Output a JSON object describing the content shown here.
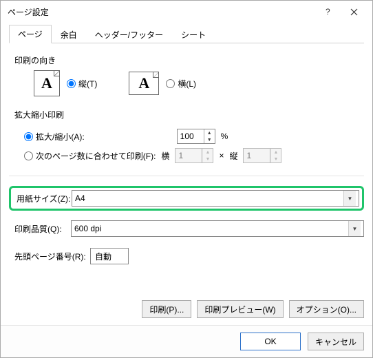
{
  "titlebar": {
    "title": "ページ設定"
  },
  "tabs": [
    "ページ",
    "余白",
    "ヘッダー/フッター",
    "シート"
  ],
  "orientation": {
    "section": "印刷の向き",
    "portrait": "縦(T)",
    "landscape": "横(L)"
  },
  "scaling": {
    "section": "拡大縮小印刷",
    "adjust": "拡大/縮小(A):",
    "adjust_value": "100",
    "percent": "%",
    "fit": "次のページ数に合わせて印刷(F):",
    "wide_label": "横",
    "wide_value": "1",
    "times": "×",
    "tall_label": "縦",
    "tall_value": "1"
  },
  "paper": {
    "label": "用紙サイズ(Z):",
    "value": "A4"
  },
  "quality": {
    "label": "印刷品質(Q):",
    "value": "600 dpi"
  },
  "firstpage": {
    "label": "先頭ページ番号(R):",
    "value": "自動"
  },
  "buttons": {
    "print": "印刷(P)...",
    "preview": "印刷プレビュー(W)",
    "options": "オプション(O)..."
  },
  "footer": {
    "ok": "OK",
    "cancel": "キャンセル"
  }
}
